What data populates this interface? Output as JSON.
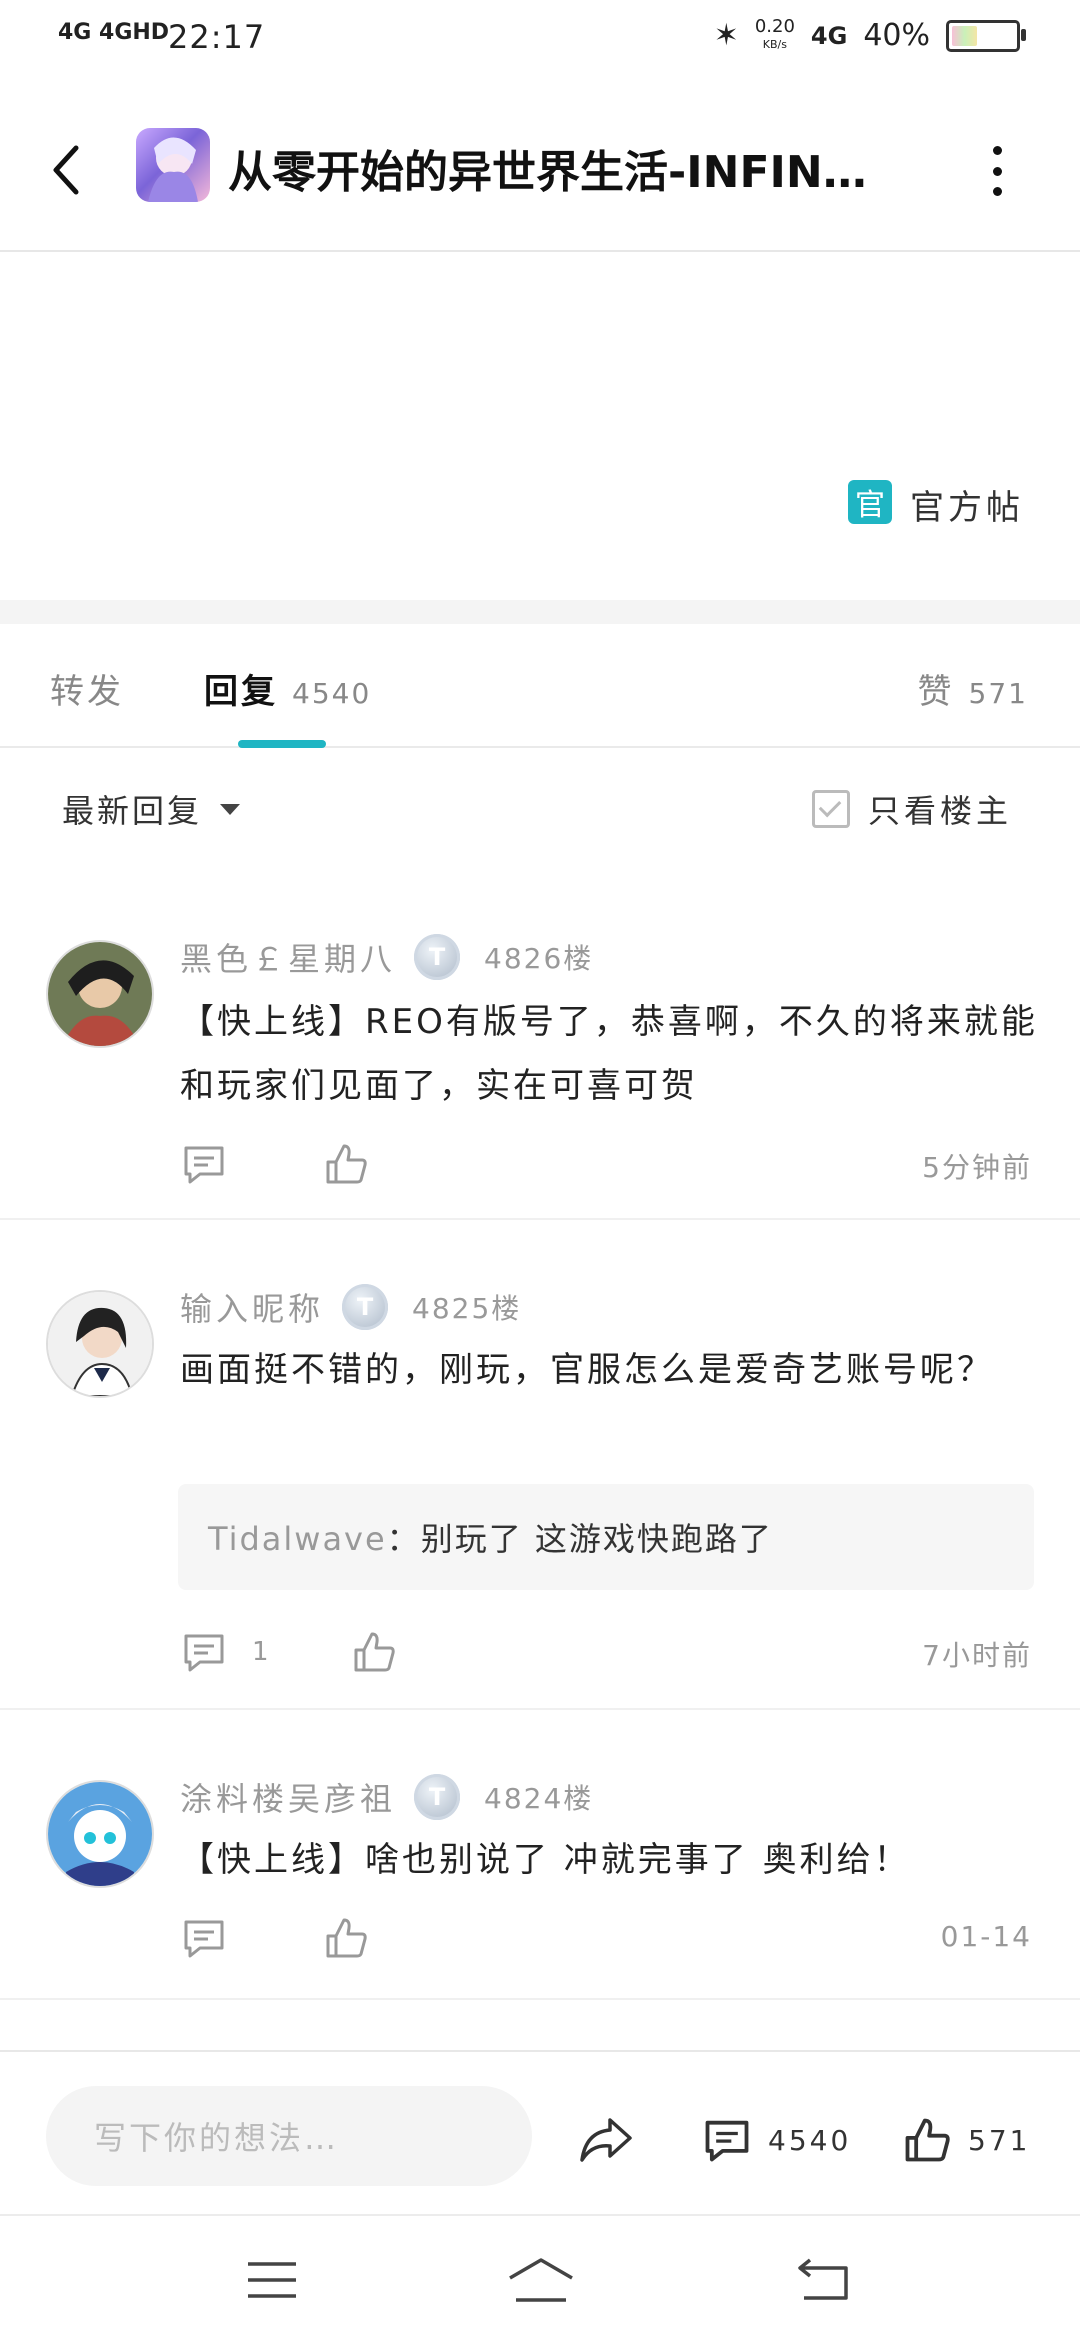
{
  "status_bar": {
    "network": "4G 4GHD",
    "time": "22:17",
    "speed": "0.20",
    "speed_unit": "KB/s",
    "sim": "4G",
    "battery": "40%",
    "battery_level": 0.4
  },
  "header": {
    "title": "从零开始的异世界生活-INFIN…"
  },
  "post": {
    "official_badge": "官",
    "official_label": "官方帖"
  },
  "tabs": {
    "forward": "转发",
    "reply": "回复",
    "reply_count": "4540",
    "like": "赞",
    "like_count": "571"
  },
  "filter": {
    "sort_label": "最新回复",
    "only_owner": "只看楼主"
  },
  "comments": [
    {
      "user": "黑色￡星期八",
      "level": "T",
      "floor": "4826楼",
      "text": "【快上线】REO有版号了，恭喜啊，不久的将来就能和玩家们见面了，实在可喜可贺",
      "reply_count": "",
      "time": "5分钟前"
    },
    {
      "user": "输入昵称",
      "level": "T",
      "floor": "4825楼",
      "text": "画面挺不错的，刚玩，官服怎么是爱奇艺账号呢？",
      "reply_user": "Tidalwave",
      "reply_sep": "：",
      "reply_text": "别玩了 这游戏快跑路了",
      "reply_count": "1",
      "time": "7小时前"
    },
    {
      "user": "涂料楼吴彦祖",
      "level": "T",
      "floor": "4824楼",
      "text": "【快上线】啥也别说了 冲就完事了 奥利给！",
      "reply_count": "",
      "time": "01-14"
    }
  ],
  "bottom_bar": {
    "input_placeholder": "写下你的想法…",
    "comment_count": "4540",
    "like_count": "571"
  },
  "colors": {
    "accent": "#1fb5c3",
    "muted_text": "#999999"
  }
}
